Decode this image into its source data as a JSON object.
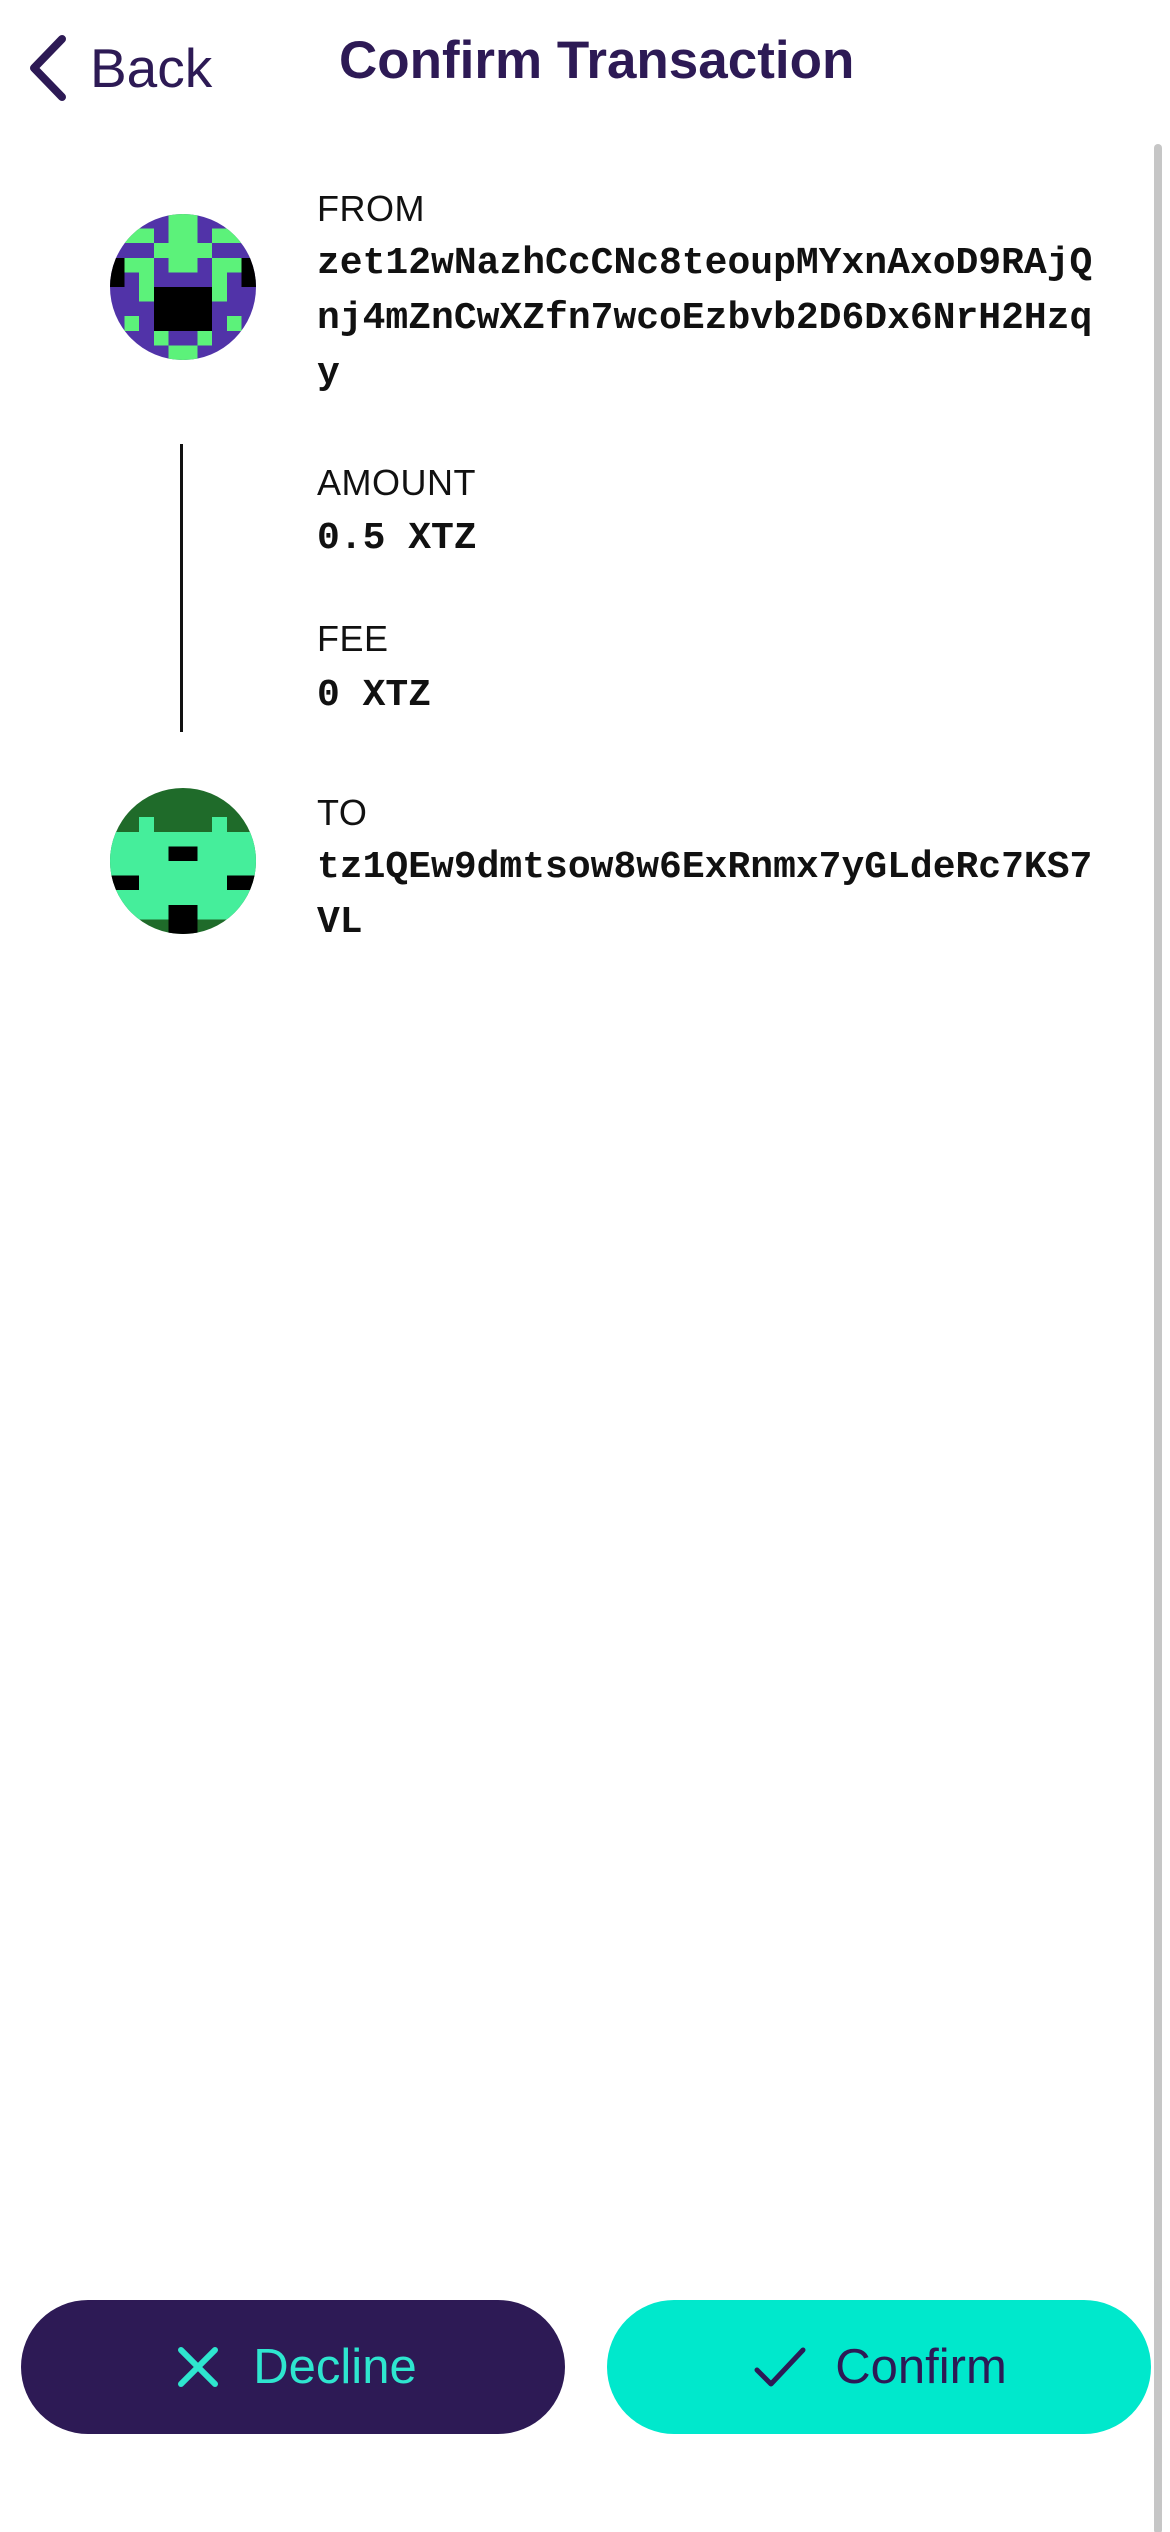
{
  "header": {
    "back_label": "Back",
    "title": "Confirm Transaction"
  },
  "transaction": {
    "from_label": "FROM",
    "from_address": "zet12wNazhCcCNc8teoupMYxnAxoD9RAjQnj4mZnCwXZfn7wcoEzbvb2D6Dx6NrH2Hzqy",
    "amount_label": "AMOUNT",
    "amount": "0.5 XTZ",
    "fee_label": "FEE",
    "fee": "0 XTZ",
    "to_label": "TO",
    "to_address": "tz1QEw9dmtsow8w6ExRnmx7yGLdeRc7KS7VL"
  },
  "actions": {
    "decline_label": "Decline",
    "confirm_label": "Confirm"
  },
  "icons": {
    "back": "chevron-left-icon",
    "decline": "close-icon",
    "confirm": "checkmark-icon"
  },
  "colors": {
    "primary_dark": "#2d1a55",
    "accent_teal": "#00e8cc",
    "from_avatar_bg": "#5133a8",
    "from_avatar_fg": "#5cf27a",
    "to_avatar_bg": "#1f6b2a",
    "to_avatar_fg": "#45ee9b"
  }
}
